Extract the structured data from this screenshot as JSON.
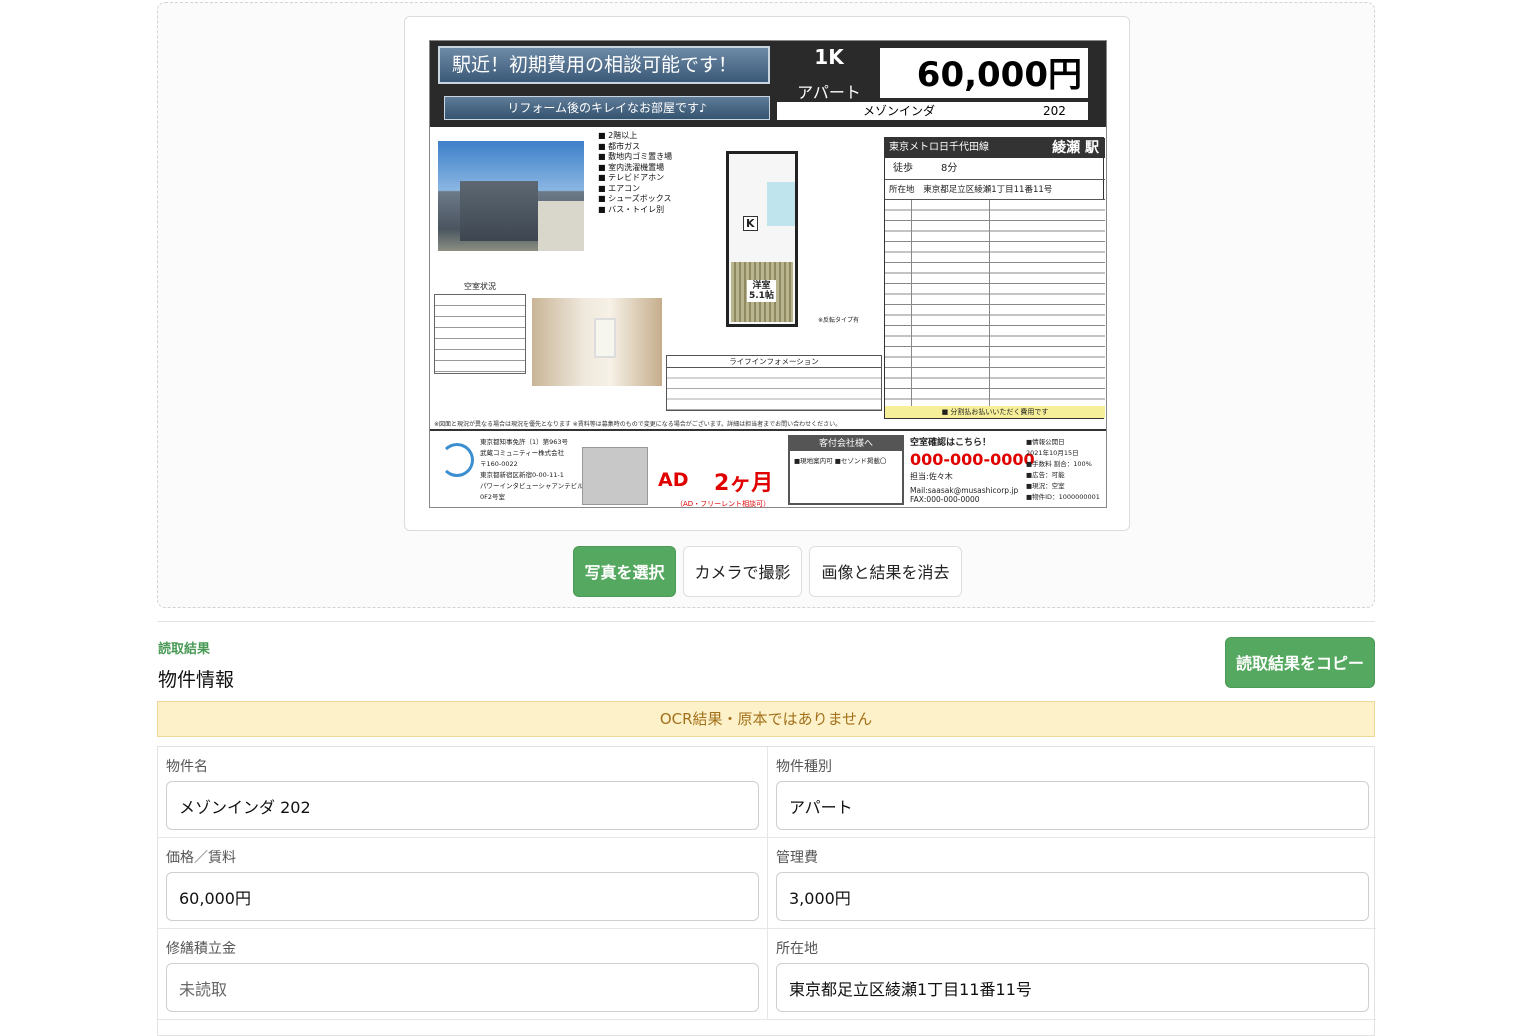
{
  "flyer": {
    "catchphrase": "駅近！初期費用の相談可能です！",
    "subcatch": "リフォーム後のキレイなお部屋です♪",
    "layout": "1K",
    "type": "アパート",
    "price": "60,000円",
    "building": "メゾンインダ",
    "room": "202",
    "line": "東京メトロ日千代田線",
    "station": "綾瀬 駅",
    "walk_label": "徒歩",
    "walk_time": "8分",
    "address_label": "所在地",
    "address": "東京都足立区綾瀬1丁目11番11号",
    "features": [
      "2階以上",
      "都市ガス",
      "敷地内ゴミ置き場",
      "室内洗濯機置場",
      "テレビドアホン",
      "エアコン",
      "シューズボックス",
      "バス・トイレ別"
    ],
    "room_label": "洋室\n5.1帖",
    "kitchen_label": "K",
    "plan_note": "※反転タイプ有",
    "vacancy_title": "空室状況",
    "life_title": "ライフインフォメーション",
    "yellow_note": "■ 分割払お払いいただく費用です",
    "notice": "※図面と現況が異なる場合は現況を優先となります ※賃料等は募集時のもので変更になる場合がございます。詳細は担当者までお問い合わせください。",
    "company_lines": [
      "東京都知事免許（1）第963号",
      "武蔵コミュニティー株式会社",
      "〒160-0022",
      "東京都新宿区新宿0-00-11-1",
      "パワーインタビューシャアンテビルズ",
      "0F2号室"
    ],
    "ad_label": "AD",
    "ad_value": "2ヶ月",
    "ad_note": "（AD・フリーレント相談可）",
    "agent_box_title": "客付会社様へ",
    "agent_box_text": "■現地案内可 ■セゾンド掲載〇",
    "contact_title": "空室確認はこちら！",
    "contact_phone": "000-000-0000",
    "contact_person": "担当:佐々木",
    "contact_mail": "Mail:saasak@musashicorp.jp",
    "contact_fax": "FAX:000-000-0000",
    "meta_lines": [
      "■情報公開日",
      "2021年10月15日",
      "■手数料  割合：100%",
      "■広告：可能",
      "■現況：空室",
      "■物件ID：1000000001"
    ]
  },
  "buttons": {
    "select_photo": "写真を選択",
    "camera": "カメラで撮影",
    "clear": "画像と結果を消去"
  },
  "result": {
    "kicker": "読取結果",
    "title": "物件情報",
    "copy_button": "読取結果をコピー",
    "warning": "OCR結果・原本ではありません"
  },
  "fields": {
    "name": {
      "label": "物件名",
      "value": "メゾンインダ 202"
    },
    "kind": {
      "label": "物件種別",
      "value": "アパート"
    },
    "price": {
      "label": "価格／賃料",
      "value": "60,000円"
    },
    "mgmt": {
      "label": "管理費",
      "value": "3,000円"
    },
    "repair": {
      "label": "修繕積立金",
      "value": "未読取"
    },
    "address": {
      "label": "所在地",
      "value": "東京都足立区綾瀬1丁目11番11号"
    }
  }
}
